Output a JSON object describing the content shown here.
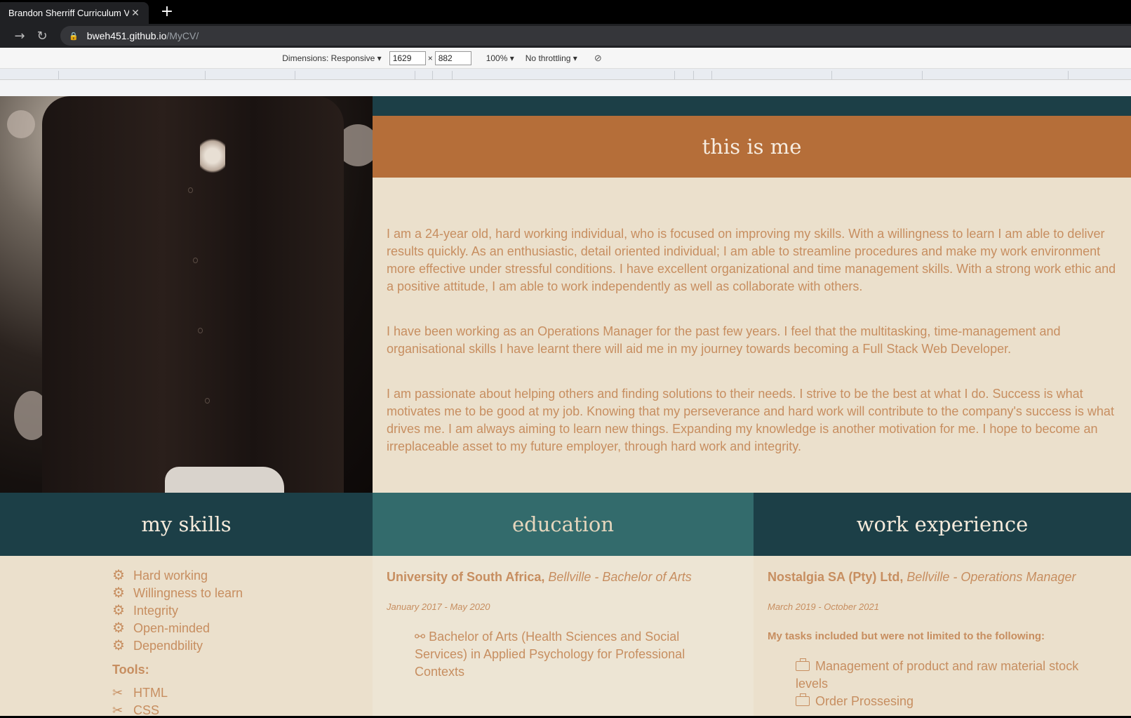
{
  "browser": {
    "tab_title": "Brandon Sherriff Curriculum Vitae",
    "tab_close": "✕",
    "new_tab": "+",
    "url_host": "bweh451.github.io",
    "url_path": "/MyCV/"
  },
  "devtools": {
    "dimensions_label": "Dimensions: Responsive ▾",
    "width": "1629",
    "times": "×",
    "height": "882",
    "zoom": "100% ▾",
    "throttling": "No throttling ▾"
  },
  "about": {
    "heading": "this is me",
    "paragraphs": [
      "I am a 24-year old, hard working individual, who is focused on improving my skills. With a willingness to learn  I am able to deliver results quickly. As an enthusiastic, detail oriented individual;  I am able to streamline procedures and make my work environment more effective under stressful conditions.  I have excellent organizational and time management skills. With a strong work ethic and a positive attitude,  I am able to work independently as well as collaborate with others.",
      "I have been working as an Operations  Manager for the past few years.  I feel that the multitasking, time-management and organisational skills  I have learnt there will aid me in my journey towards becoming a  Full Stack Web  Developer.",
      "I am passionate about helping others and finding solutions to their needs.  I strive to be the best at what  I do. Success is what motivates me to be good at my job.  Knowing that my perseverance and hard work will contribute to the company's success is what drives me.  I am always aiming to learn new things.  Expanding my knowledge is another motivation for me.  I hope to become an irreplaceable asset to my future employer, through hard work and integrity."
    ]
  },
  "skills": {
    "heading": "my skills",
    "items": [
      "Hard working",
      "Willingness to learn",
      "Integrity",
      "Open-minded",
      "Dependbility"
    ],
    "tools_label": "Tools:",
    "tools": [
      "HTML",
      "CSS"
    ]
  },
  "education": {
    "heading": "education",
    "school": "University of South Africa,",
    "location_degree": " Bellville -  Bachelor of Arts",
    "dates": "January 2017 -  May 2020",
    "detail": "Bachelor of Arts (Health Sciences and Social Services) in Applied  Psychology for  Professional Contexts"
  },
  "work": {
    "heading": "work experience",
    "company": "Nostalgia SA (Pty)  Ltd,",
    "location_role": " Bellville - Operations  Manager",
    "dates": "March 2019 - October 2021",
    "tasks_label": "My tasks included but were not limited to the following:",
    "tasks": [
      "Management of product and raw material stock levels",
      "Order  Prossesing"
    ]
  },
  "colors": {
    "accent_orange": "#b56e39",
    "dark_teal": "#1c3f47",
    "mid_teal": "#336b6c",
    "text_tan": "#c78e60",
    "background": "#ebe0cc"
  },
  "icons": {
    "skill": "gear-icon",
    "tool": "tools-icon",
    "education": "glasses-icon",
    "task": "briefcase-icon"
  }
}
